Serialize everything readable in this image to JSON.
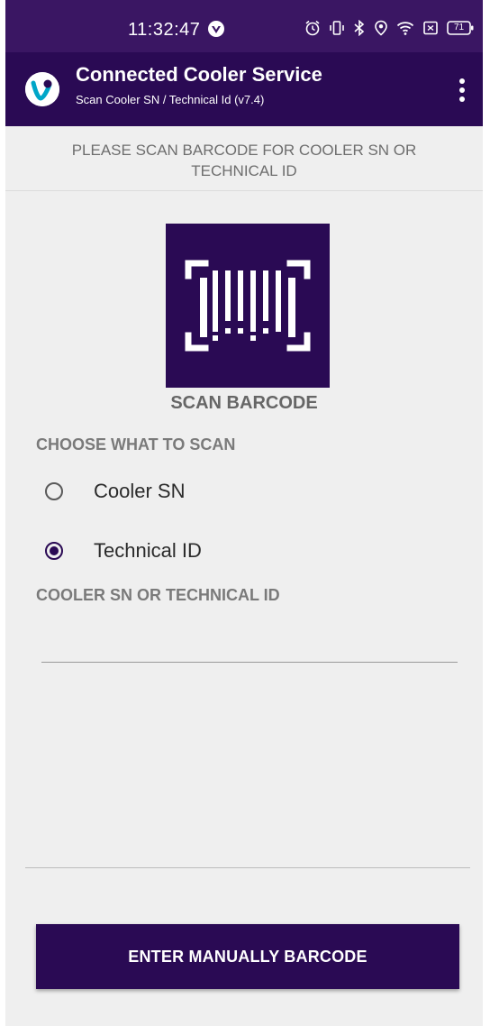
{
  "status_bar": {
    "time": "11:32:47",
    "battery": "71"
  },
  "app_bar": {
    "title": "Connected Cooler Service",
    "subtitle": "Scan Cooler SN / Technical Id (v7.4)"
  },
  "instruction": "PLEASE SCAN BARCODE FOR COOLER SN OR TECHNICAL ID",
  "scan": {
    "label": "SCAN BARCODE",
    "icon": "barcode-scan-icon"
  },
  "choose": {
    "heading": "CHOOSE WHAT TO SCAN",
    "options": [
      {
        "label": "Cooler SN",
        "selected": false
      },
      {
        "label": "Technical ID",
        "selected": true
      }
    ]
  },
  "field": {
    "heading": "COOLER SN OR TECHNICAL ID",
    "value": ""
  },
  "manual_button": "ENTER MANUALLY BARCODE",
  "colors": {
    "primary": "#2a0a54",
    "status_bar": "#3a1663",
    "background": "#efefef"
  }
}
